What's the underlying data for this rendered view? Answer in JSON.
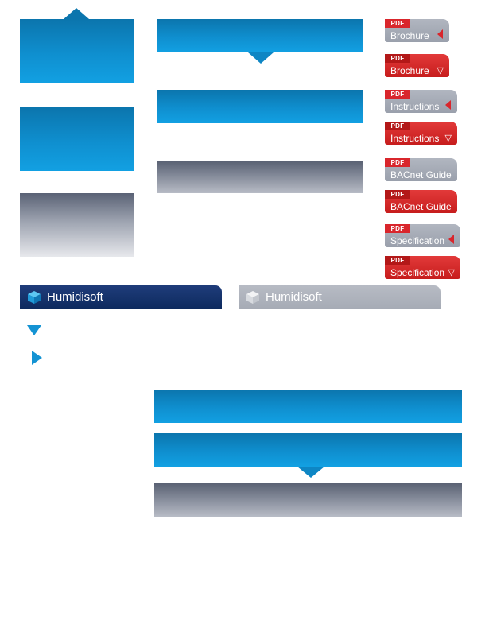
{
  "pdf_buttons": [
    {
      "tag": "PDF",
      "label": "Brochure",
      "style": "gray",
      "arrow": "left"
    },
    {
      "tag": "PDF",
      "label": "Brochure",
      "style": "red",
      "arrow": "down"
    },
    {
      "tag": "PDF",
      "label": "Instructions",
      "style": "gray",
      "arrow": "left"
    },
    {
      "tag": "PDF",
      "label": "Instructions",
      "style": "red",
      "arrow": "down"
    },
    {
      "tag": "PDF",
      "label": "BACnet Guide",
      "style": "gray",
      "arrow": "none"
    },
    {
      "tag": "PDF",
      "label": "BACnet Guide",
      "style": "red",
      "arrow": "none"
    },
    {
      "tag": "PDF",
      "label": "Specification",
      "style": "gray",
      "arrow": "left"
    },
    {
      "tag": "PDF",
      "label": "Specification",
      "style": "red",
      "arrow": "down"
    }
  ],
  "tabs": [
    {
      "label": "Humidisoft",
      "state": "active"
    },
    {
      "label": "Humidisoft",
      "state": "inactive"
    }
  ],
  "icons": {
    "cube_active": "cube-icon",
    "cube_inactive": "cube-icon",
    "triangle_down": "triangle-down-icon",
    "triangle_right": "triangle-right-icon"
  },
  "colors": {
    "blue_gradient_top": "#0b75ad",
    "blue_gradient_bottom": "#12a0e2",
    "gray_gradient_top": "#5a6275",
    "pdf_red": "#d9262c",
    "pdf_gray": "#aab0ba",
    "tab_navy": "#1a3670",
    "arrow_blue": "#1493d3"
  }
}
